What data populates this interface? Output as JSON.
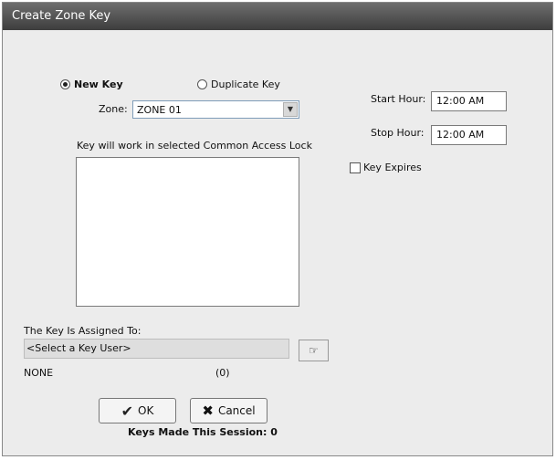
{
  "dialog": {
    "title": "Create Zone Key",
    "key_type": {
      "new_key_label": "New Key",
      "duplicate_key_label": "Duplicate Key",
      "selected": "New Key"
    },
    "zone": {
      "label": "Zone:",
      "value": "ZONE 01"
    },
    "lock_list": {
      "label": "Key will work in selected Common Access Lock",
      "items": []
    },
    "start_hour": {
      "label": "Start Hour:",
      "value": "12:00 AM"
    },
    "stop_hour": {
      "label": "Stop Hour:",
      "value": "12:00 AM"
    },
    "key_expires": {
      "label": "Key Expires",
      "checked": false
    },
    "assigned": {
      "label": "The Key Is Assigned To:",
      "value": "<Select a Key User>",
      "user_name": "NONE",
      "user_id": "(0)"
    },
    "buttons": {
      "ok_label": "OK",
      "cancel_label": "Cancel"
    },
    "session_status": "Keys Made This Session: 0"
  }
}
